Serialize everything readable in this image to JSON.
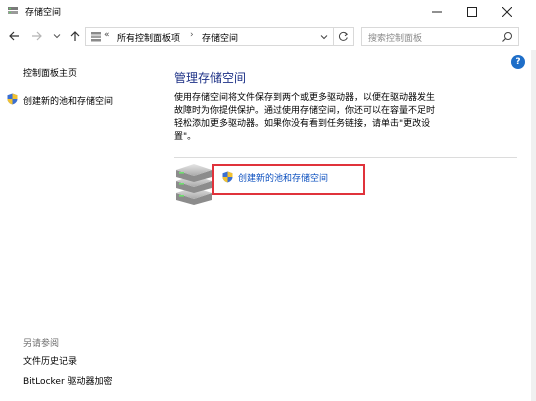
{
  "window": {
    "title": "存储空间",
    "minimize_label": "–",
    "maximize_label": "☐",
    "close_label": "✕"
  },
  "nav": {
    "back_icon": "back-arrow-icon",
    "forward_icon": "forward-arrow-icon",
    "recent_icon": "chevron-down-icon",
    "up_icon": "up-arrow-icon"
  },
  "address": {
    "chevron": "«",
    "crumb1": "所有控制面板项",
    "separator": "›",
    "crumb2": "存储空间"
  },
  "search": {
    "placeholder": "搜索控制面板"
  },
  "help": {
    "label": "?"
  },
  "sidebar": {
    "home": "控制面板主页",
    "create": "创建新的池和存储空间",
    "see_also_title": "另请参阅",
    "see_also": [
      "文件历史记录",
      "BitLocker 驱动器加密"
    ]
  },
  "main": {
    "title": "管理存储空间",
    "description": "使用存储空间将文件保存到两个或更多驱动器，以便在驱动器发生故障时为你提供保护。通过使用存储空间，你还可以在容量不足时轻松添加更多驱动器。如果你没有看到任务链接，请单击\"更改设置\"。",
    "create_link": "创建新的池和存储空间"
  },
  "colors": {
    "title_blue": "#1e3287",
    "link_blue": "#0b4fbf",
    "highlight_red": "#e0323b",
    "help_blue": "#1e6ec8"
  }
}
